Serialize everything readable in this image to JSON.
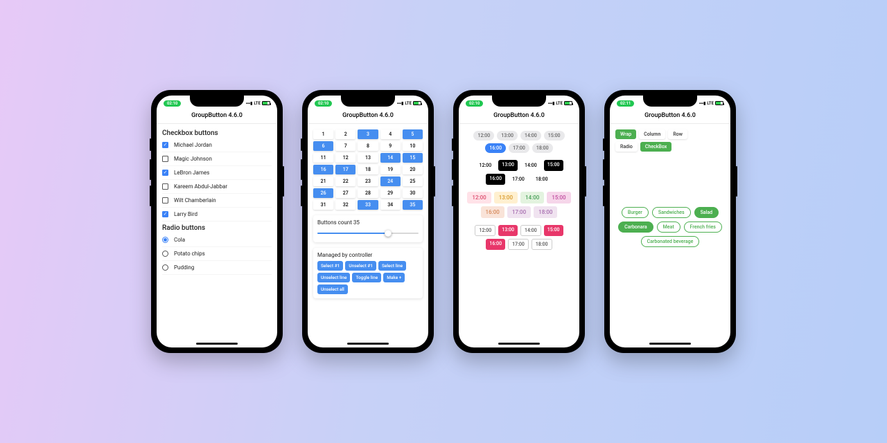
{
  "status": {
    "time1": "02:10",
    "time4": "02:11",
    "net": "LTE"
  },
  "app_title": "GroupButton 4.6.0",
  "phone1": {
    "checkbox_header": "Checkbox buttons",
    "radio_header": "Radio buttons",
    "players": [
      {
        "label": "Michael Jordan",
        "checked": true
      },
      {
        "label": "Magic Johnson",
        "checked": false
      },
      {
        "label": "LeBron James",
        "checked": true
      },
      {
        "label": "Kareem Abdul-Jabbar",
        "checked": false
      },
      {
        "label": "Wilt Chamberlain",
        "checked": false
      },
      {
        "label": "Larry Bird",
        "checked": true
      }
    ],
    "snacks": [
      {
        "label": "Cola",
        "checked": true
      },
      {
        "label": "Potato chips",
        "checked": false
      },
      {
        "label": "Pudding",
        "checked": false
      }
    ]
  },
  "phone2": {
    "numbers": [
      1,
      2,
      3,
      4,
      5,
      6,
      7,
      8,
      9,
      10,
      11,
      12,
      13,
      14,
      15,
      16,
      17,
      18,
      19,
      20,
      21,
      22,
      23,
      24,
      25,
      26,
      27,
      28,
      29,
      30,
      31,
      32,
      33,
      34,
      35
    ],
    "selected": [
      3,
      5,
      6,
      14,
      15,
      16,
      17,
      24,
      26,
      33,
      35
    ],
    "slider_label": "Buttons count 35",
    "slider_max": 50,
    "slider_val": 35,
    "controller_header": "Managed by controller",
    "controller_btns": [
      "Select #1",
      "Unselect #1",
      "Select line",
      "Unselect line",
      "Toggle line",
      "Make +",
      "Unselect all"
    ]
  },
  "phone3": {
    "grp1": {
      "times": [
        "12:00",
        "13:00",
        "14:00",
        "15:00",
        "16:00",
        "17:00",
        "18:00"
      ],
      "sel": [
        "16:00"
      ]
    },
    "grp2": {
      "times": [
        "12:00",
        "13:00",
        "14:00",
        "15:00",
        "16:00",
        "17:00",
        "18:00"
      ],
      "sel": [
        "13:00",
        "15:00",
        "16:00"
      ]
    },
    "grp3": {
      "times": [
        "12:00",
        "13:00",
        "14:00",
        "15:00",
        "16:00",
        "17:00",
        "18:00"
      ],
      "styles": [
        "pink",
        "yel",
        "grn",
        "mag",
        "pch",
        "lil",
        "lil-plain"
      ]
    },
    "grp4": {
      "times": [
        "12:00",
        "13:00",
        "14:00",
        "15:00",
        "16:00",
        "17:00",
        "18:00"
      ],
      "sel": [
        "13:00",
        "15:00",
        "16:00"
      ]
    }
  },
  "phone4": {
    "layout": [
      "Wrap",
      "Column",
      "Row"
    ],
    "layout_sel": "Wrap",
    "mode": [
      "Radio",
      "CheckBox"
    ],
    "mode_sel": "CheckBox",
    "foods": [
      "Burger",
      "Sandwiches",
      "Salad",
      "Carbonara",
      "Meat",
      "French fries",
      "Carbonated beverage"
    ],
    "foods_sel": [
      "Salad",
      "Carbonara"
    ]
  }
}
